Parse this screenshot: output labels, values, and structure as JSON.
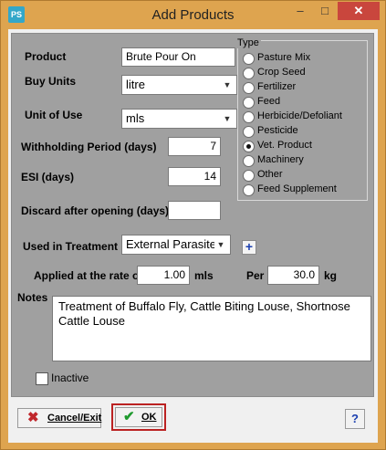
{
  "window": {
    "title": "Add Products",
    "app_icon_text": "PS",
    "controls": {
      "minimize": "–",
      "maximize": "□",
      "close": "✕"
    }
  },
  "form": {
    "product": {
      "label": "Product",
      "value": "Brute Pour On"
    },
    "buy_units": {
      "label": "Buy Units",
      "value": "litre"
    },
    "unit_of_use": {
      "label": "Unit of Use",
      "value": "mls"
    },
    "withholding_period": {
      "label": "Withholding Period (days)",
      "value": "7"
    },
    "esi": {
      "label": "ESI (days)",
      "value": "14"
    },
    "discard_after_opening": {
      "label": "Discard after opening (days)",
      "value": ""
    },
    "used_in_treatment": {
      "label": "Used in Treatment",
      "value": "External Parasite",
      "add_label": "+"
    },
    "applied_rate": {
      "label": "Applied at the rate of",
      "value": "1.00",
      "unit": "mls"
    },
    "per": {
      "label": "Per",
      "value": "30.0",
      "unit": "kg"
    },
    "notes": {
      "label": "Notes",
      "value": "Treatment of Buffalo Fly, Cattle Biting Louse, Shortnose Cattle Louse"
    },
    "inactive": {
      "label": "Inactive",
      "checked": false
    }
  },
  "type_group": {
    "title": "Type",
    "selected": "Vet. Product",
    "options": [
      "Pasture Mix",
      "Crop Seed",
      "Fertilizer",
      "Feed",
      "Herbicide/Defoliant",
      "Pesticide",
      "Vet. Product",
      "Machinery",
      "Other",
      "Feed Supplement"
    ]
  },
  "buttons": {
    "cancel": {
      "label": "Cancel/Exit",
      "icon": "red-x-icon"
    },
    "ok": {
      "label": "OK",
      "icon": "green-check-icon"
    },
    "help": {
      "label": "?"
    }
  },
  "colors": {
    "title_bar": "#dea44f",
    "panel": "#a0a0a0",
    "close_button": "#c9463d",
    "focus_outline": "#b22222"
  }
}
